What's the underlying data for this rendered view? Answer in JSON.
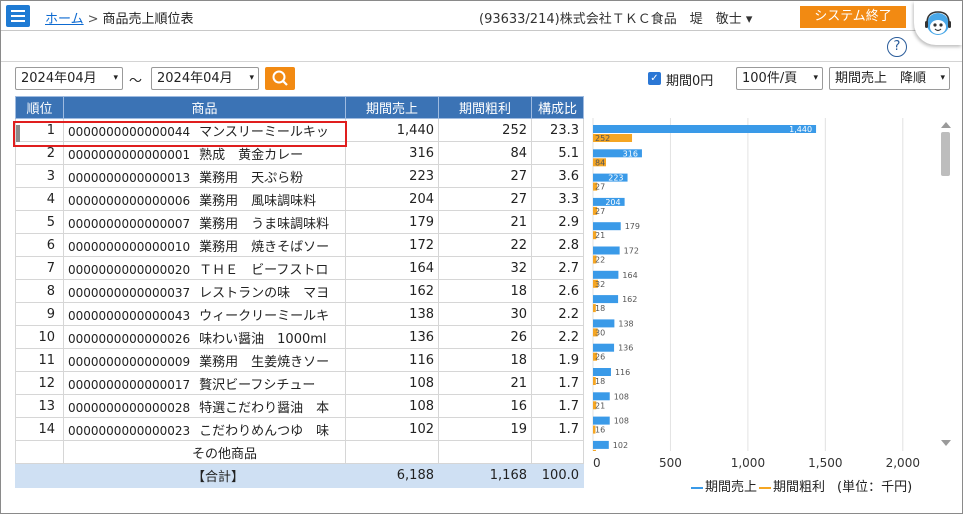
{
  "nav": {
    "home": "ホーム",
    "separator": ">",
    "page_title": "商品売上順位表"
  },
  "user": {
    "info": "(93633/214)株式会社ＴＫＣ食品　堤　敬士 ▾"
  },
  "header": {
    "exit_label": "システム終了",
    "help": "?"
  },
  "filters": {
    "from_month": "2024年04月",
    "tilde": "～",
    "to_month": "2024年04月",
    "zero_label": "期間0円",
    "page_size": "100件/頁",
    "sort": "期間売上　降順",
    "checkmark": "✓",
    "caret": "▾"
  },
  "columns": [
    "順位",
    "商品",
    "期間売上",
    "期間粗利",
    "構成比"
  ],
  "rows": [
    {
      "rank": "1",
      "code": "0000000000000044",
      "name": "マンスリーミールキッ",
      "sales": "1,440",
      "profit": "252",
      "ratio": "23.3"
    },
    {
      "rank": "2",
      "code": "0000000000000001",
      "name": "熟成　黄金カレー",
      "sales": "316",
      "profit": "84",
      "ratio": "5.1"
    },
    {
      "rank": "3",
      "code": "0000000000000013",
      "name": "業務用　天ぷら粉",
      "sales": "223",
      "profit": "27",
      "ratio": "3.6"
    },
    {
      "rank": "4",
      "code": "0000000000000006",
      "name": "業務用　風味調味料",
      "sales": "204",
      "profit": "27",
      "ratio": "3.3"
    },
    {
      "rank": "5",
      "code": "0000000000000007",
      "name": "業務用　うま味調味料",
      "sales": "179",
      "profit": "21",
      "ratio": "2.9"
    },
    {
      "rank": "6",
      "code": "0000000000000010",
      "name": "業務用　焼きそばソー",
      "sales": "172",
      "profit": "22",
      "ratio": "2.8"
    },
    {
      "rank": "7",
      "code": "0000000000000020",
      "name": "ＴＨＥ　ビーフストロ",
      "sales": "164",
      "profit": "32",
      "ratio": "2.7"
    },
    {
      "rank": "8",
      "code": "0000000000000037",
      "name": "レストランの味　マヨ",
      "sales": "162",
      "profit": "18",
      "ratio": "2.6"
    },
    {
      "rank": "9",
      "code": "0000000000000043",
      "name": "ウィークリーミールキ",
      "sales": "138",
      "profit": "30",
      "ratio": "2.2"
    },
    {
      "rank": "10",
      "code": "0000000000000026",
      "name": "味わい醤油　1000ml",
      "sales": "136",
      "profit": "26",
      "ratio": "2.2"
    },
    {
      "rank": "11",
      "code": "0000000000000009",
      "name": "業務用　生姜焼きソー",
      "sales": "116",
      "profit": "18",
      "ratio": "1.9"
    },
    {
      "rank": "12",
      "code": "0000000000000017",
      "name": "贅沢ビーフシチュー",
      "sales": "108",
      "profit": "21",
      "ratio": "1.7"
    },
    {
      "rank": "13",
      "code": "0000000000000028",
      "name": "特選こだわり醤油　本",
      "sales": "108",
      "profit": "16",
      "ratio": "1.7"
    },
    {
      "rank": "14",
      "code": "0000000000000023",
      "name": "こだわりめんつゆ　味",
      "sales": "102",
      "profit": "19",
      "ratio": "1.7"
    }
  ],
  "other": {
    "label": "その他商品"
  },
  "total": {
    "label": "【合計】",
    "sales": "6,188",
    "profit": "1,168",
    "ratio": "100.0"
  },
  "chart_data": {
    "type": "bar",
    "orientation": "horizontal",
    "categories": [
      "1",
      "2",
      "3",
      "4",
      "5",
      "6",
      "7",
      "8",
      "9",
      "10",
      "11",
      "12",
      "13",
      "14"
    ],
    "series": [
      {
        "name": "期間売上",
        "color": "#3a9ae8",
        "values": [
          1440,
          316,
          223,
          204,
          179,
          172,
          164,
          162,
          138,
          136,
          116,
          108,
          108,
          102
        ]
      },
      {
        "name": "期間粗利",
        "color": "#f5a623",
        "values": [
          252,
          84,
          27,
          27,
          21,
          22,
          32,
          18,
          30,
          26,
          18,
          21,
          16,
          19
        ]
      }
    ],
    "xlim": [
      0,
      2300
    ],
    "xticks": [
      "0",
      "500",
      "1,000",
      "1,500",
      "2,000"
    ],
    "xtick_values": [
      0,
      500,
      1000,
      1500,
      2000
    ],
    "unit": "(単位：千円)",
    "legend_position": "bottom-right"
  }
}
